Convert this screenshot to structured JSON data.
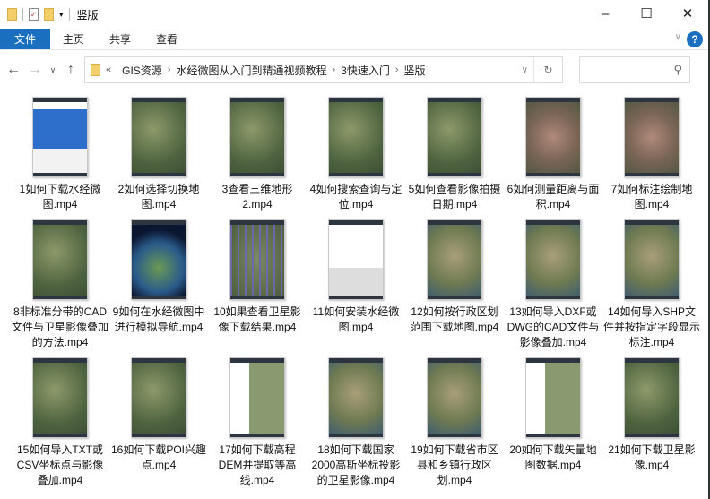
{
  "window": {
    "title": "竖版",
    "minimize": "–",
    "maximize": "☐",
    "close": "✕"
  },
  "ribbon": {
    "tabs": [
      "文件",
      "主页",
      "共享",
      "查看"
    ],
    "help": "?"
  },
  "address": {
    "overflow": "«",
    "crumbs": [
      "GIS资源",
      "水经微图从入门到精通视频教程",
      "3快速入门",
      "竖版"
    ]
  },
  "search": {
    "placeholder": ""
  },
  "files": [
    {
      "name": "1如何下载水经微图.mp4",
      "thumb": "web"
    },
    {
      "name": "2如何选择切换地图.mp4",
      "thumb": "sat"
    },
    {
      "name": "3查看三维地形2.mp4",
      "thumb": "sat"
    },
    {
      "name": "4如何搜索查询与定位.mp4",
      "thumb": "sat"
    },
    {
      "name": "5如何查看影像拍摄日期.mp4",
      "thumb": "sat"
    },
    {
      "name": "6如何测量距离与面积.mp4",
      "thumb": "city"
    },
    {
      "name": "7如何标注绘制地图.mp4",
      "thumb": "city"
    },
    {
      "name": "8非标准分带的CAD文件与卫星影像叠加的方法.mp4",
      "thumb": "sat"
    },
    {
      "name": "9如何在水经微图中进行模拟导航.mp4",
      "thumb": "globe"
    },
    {
      "name": "10如果查看卫星影像下载结果.mp4",
      "thumb": "grid"
    },
    {
      "name": "11如何安装水经微图.mp4",
      "thumb": "app"
    },
    {
      "name": "12如何按行政区划范围下载地图.mp4",
      "thumb": "land"
    },
    {
      "name": "13如何导入DXF或DWG的CAD文件与影像叠加.mp4",
      "thumb": "land"
    },
    {
      "name": "14如何导入SHP文件并按指定字段显示标注.mp4",
      "thumb": "land"
    },
    {
      "name": "15如何导入TXT或CSV坐标点与影像叠加.mp4",
      "thumb": "sat"
    },
    {
      "name": "16如何下载POI兴趣点.mp4",
      "thumb": "sat"
    },
    {
      "name": "17如何下载高程DEM并提取等高线.mp4",
      "thumb": "list"
    },
    {
      "name": "18如何下载国家2000高斯坐标投影的卫星影像.mp4",
      "thumb": "land"
    },
    {
      "name": "19如何下载省市区县和乡镇行政区划.mp4",
      "thumb": "land"
    },
    {
      "name": "20如何下载矢量地图数据.mp4",
      "thumb": "list"
    },
    {
      "name": "21如何下载卫星影像.mp4",
      "thumb": "sat"
    }
  ]
}
